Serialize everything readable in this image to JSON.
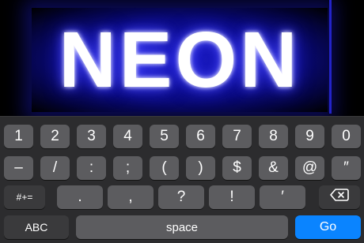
{
  "display": {
    "text": "NEON",
    "glow_color": "#1616b8",
    "cursor_color": "#2323c8"
  },
  "keyboard": {
    "row1": [
      "1",
      "2",
      "3",
      "4",
      "5",
      "6",
      "7",
      "8",
      "9",
      "0"
    ],
    "row2": [
      "–",
      "/",
      ":",
      ";",
      "(",
      ")",
      "$",
      "&",
      "@",
      "″"
    ],
    "row3": {
      "shift_label": "#+=",
      "keys": [
        ".",
        ",",
        "?",
        "!",
        "′"
      ],
      "delete_icon": "backspace-icon"
    },
    "row4": {
      "abc_label": "ABC",
      "space_label": "space",
      "go_label": "Go"
    },
    "accent_color": "#0a84ff"
  }
}
